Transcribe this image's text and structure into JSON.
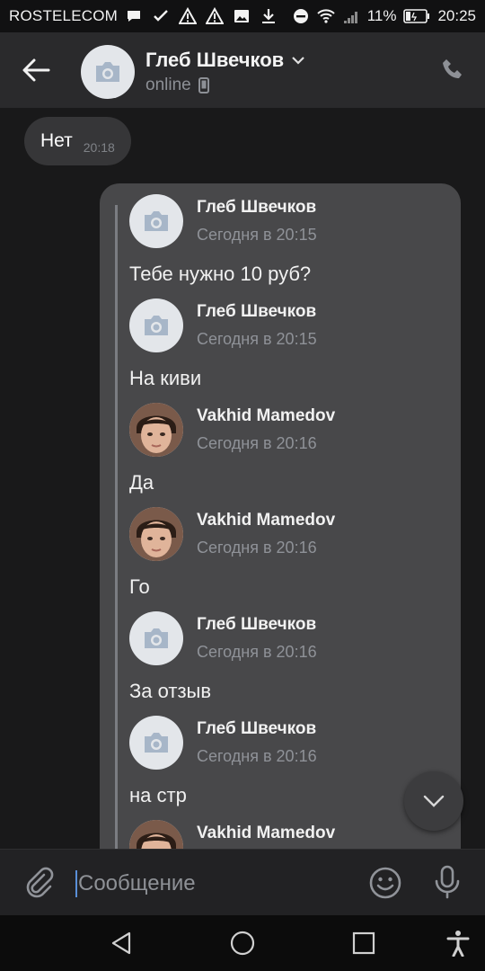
{
  "status_bar": {
    "carrier": "ROSTELECOM",
    "battery": "11%",
    "time": "20:25"
  },
  "header": {
    "name": "Глеб Швечков",
    "status": "online"
  },
  "messages": {
    "incoming": {
      "text": "Нет",
      "time": "20:18"
    },
    "forwarded": [
      {
        "author": "Глеб Швечков",
        "time": "Сегодня в 20:15",
        "text": "Тебе нужно 10 руб?",
        "avatar": "placeholder"
      },
      {
        "author": "Глеб Швечков",
        "time": "Сегодня в 20:15",
        "text": "На киви",
        "avatar": "placeholder"
      },
      {
        "author": "Vakhid Mamedov",
        "time": "Сегодня в 20:16",
        "text": "Да",
        "avatar": "photo"
      },
      {
        "author": "Vakhid Mamedov",
        "time": "Сегодня в 20:16",
        "text": "Го",
        "avatar": "photo"
      },
      {
        "author": "Глеб Швечков",
        "time": "Сегодня в 20:16",
        "text": "За отзыв",
        "avatar": "placeholder"
      },
      {
        "author": "Глеб Швечков",
        "time": "Сегодня в 20:16",
        "text": "на стр",
        "avatar": "placeholder"
      },
      {
        "author": "Vakhid Mamedov",
        "time": "",
        "text": "",
        "avatar": "photo"
      }
    ]
  },
  "composer": {
    "placeholder": "Сообщение"
  },
  "colors": {
    "accent_caret": "#5a8fd8",
    "background": "#19191a",
    "bubble": "#48484a"
  }
}
